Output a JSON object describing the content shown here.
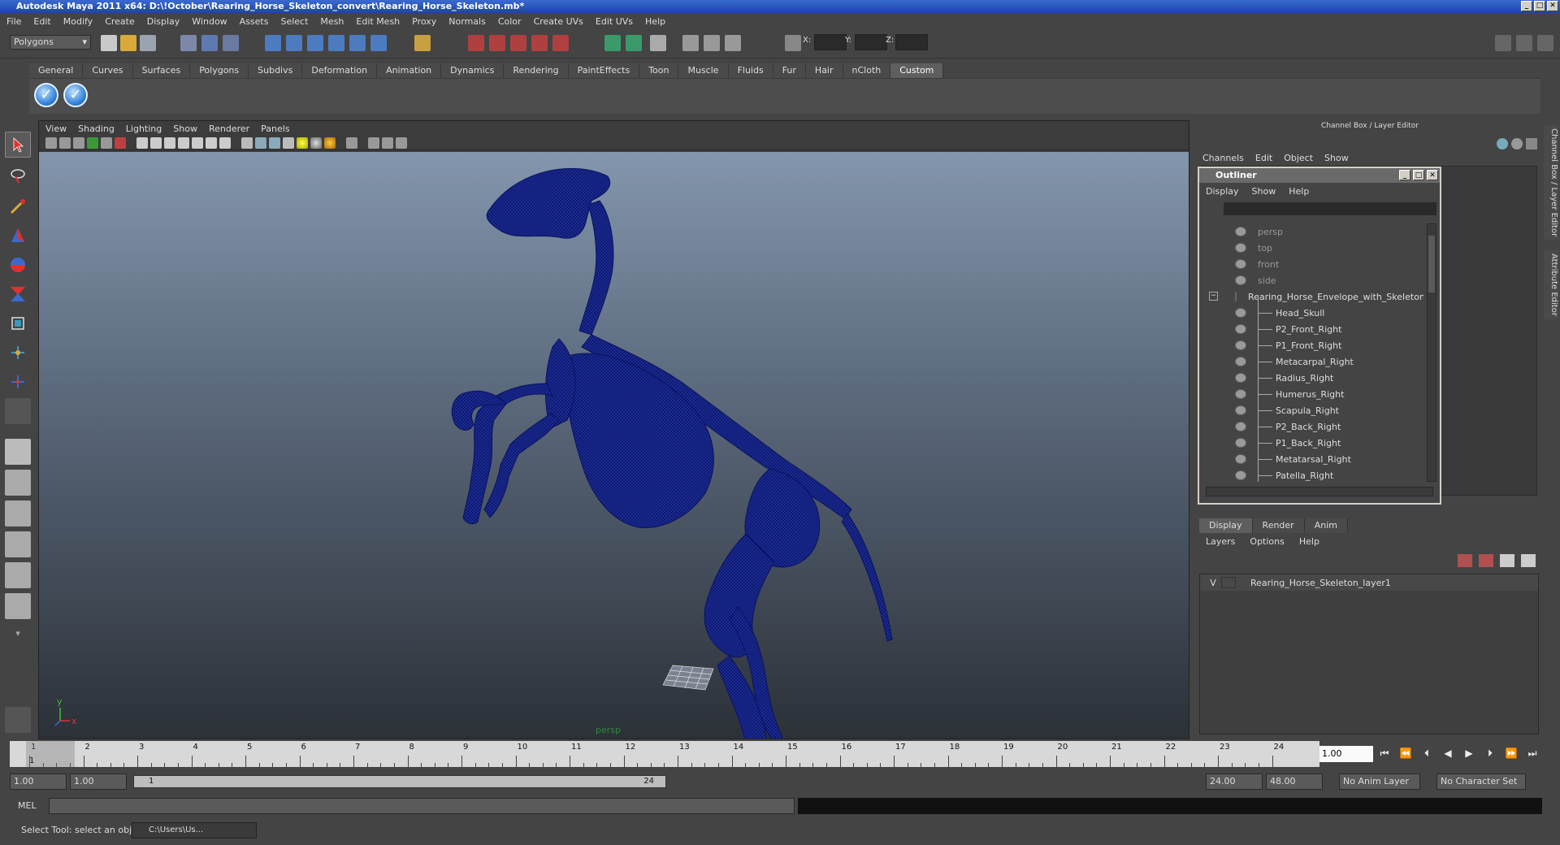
{
  "window": {
    "title": "Autodesk Maya 2011 x64: D:\\!October\\Rearing_Horse_Skeleton_convert\\Rearing_Horse_Skeleton.mb*",
    "btn_min": "_",
    "btn_max": "□",
    "btn_close": "✕"
  },
  "menus": [
    "File",
    "Edit",
    "Modify",
    "Create",
    "Display",
    "Window",
    "Assets",
    "Select",
    "Mesh",
    "Edit Mesh",
    "Proxy",
    "Normals",
    "Color",
    "Create UVs",
    "Edit UVs",
    "Help"
  ],
  "statusline": {
    "mode": "Polygons",
    "x_label": "X:",
    "y_label": "Y:",
    "z_label": "Z:"
  },
  "shelf": {
    "tabs": [
      "General",
      "Curves",
      "Surfaces",
      "Polygons",
      "Subdivs",
      "Deformation",
      "Animation",
      "Dynamics",
      "Rendering",
      "PaintEffects",
      "Toon",
      "Muscle",
      "Fluids",
      "Fur",
      "Hair",
      "nCloth",
      "Custom"
    ],
    "active_tab": "Custom"
  },
  "viewport": {
    "menus": [
      "View",
      "Shading",
      "Lighting",
      "Show",
      "Renderer",
      "Panels"
    ],
    "camera_label": "persp",
    "axis_y": "y",
    "axis_x": "x",
    "mesh_color": "#0d1a78"
  },
  "channel_box": {
    "title": "Channel Box / Layer Editor",
    "menus": [
      "Channels",
      "Edit",
      "Object",
      "Show"
    ]
  },
  "outliner": {
    "title": "Outliner",
    "menus": [
      "Display",
      "Show",
      "Help"
    ],
    "cameras": [
      "persp",
      "top",
      "front",
      "side"
    ],
    "root": "Rearing_Horse_Envelope_with_Skeleton",
    "children": [
      "Head_Skull",
      "P2_Front_Right",
      "P1_Front_Right",
      "Metacarpal_Right",
      "Radius_Right",
      "Humerus_Right",
      "Scapula_Right",
      "P2_Back_Right",
      "P1_Back_Right",
      "Metatarsal_Right",
      "Patella_Right"
    ]
  },
  "layer_editor": {
    "tabs": [
      "Display",
      "Render",
      "Anim"
    ],
    "active_tab": "Display",
    "menus": [
      "Layers",
      "Options",
      "Help"
    ],
    "layers": [
      {
        "visible": "V",
        "name": "Rearing_Horse_Skeleton_layer1"
      }
    ]
  },
  "side_tabs": [
    "Channel Box / Layer Editor",
    "Attribute Editor"
  ],
  "timeline": {
    "ticks": [
      "1",
      "2",
      "3",
      "4",
      "5",
      "6",
      "7",
      "8",
      "9",
      "10",
      "11",
      "12",
      "13",
      "14",
      "15",
      "16",
      "17",
      "18",
      "19",
      "20",
      "21",
      "22",
      "23",
      "24"
    ],
    "current_frame": "1.00",
    "current_marker": "1"
  },
  "range": {
    "start": "1.00",
    "playback_start": "1.00",
    "slider_start": "1",
    "slider_end": "24",
    "playback_end": "24.00",
    "end": "48.00",
    "anim_layer": "No Anim Layer",
    "character_set": "No Character Set"
  },
  "command": {
    "label": "MEL"
  },
  "help": {
    "text": "Select Tool: select an object",
    "task": "C:\\Users\\Us..."
  }
}
